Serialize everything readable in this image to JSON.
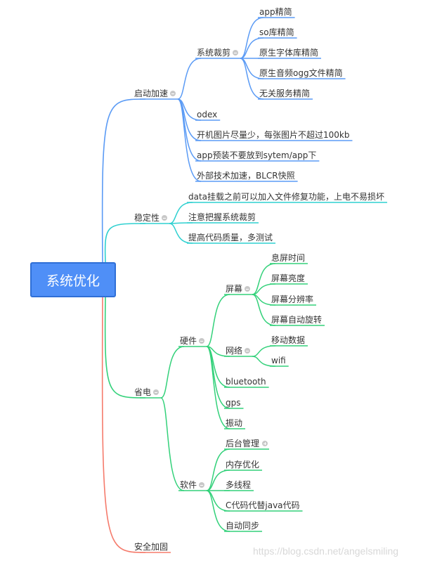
{
  "root": {
    "label": "系统优化",
    "color": "#4f8ff7"
  },
  "branches": {
    "startup": {
      "label": "启动加速",
      "color": "#5b9bf5",
      "tailor": {
        "label": "系统裁剪",
        "items": [
          "app精简",
          "so库精简",
          "原生字体库精简",
          "原生音频ogg文件精简",
          "无关服务精简"
        ]
      },
      "items": [
        "odex",
        "开机图片尽量少，每张图片不超过100kb",
        "app预装不要放到sytem/app下",
        "外部技术加速，BLCR快照"
      ]
    },
    "stability": {
      "label": "稳定性",
      "color": "#2fd0d0",
      "items": [
        "data挂载之前可以加入文件修复功能，上电不易损坏",
        "注意把握系统裁剪",
        "提高代码质量，多测试"
      ]
    },
    "power": {
      "label": "省电",
      "color": "#33d17a",
      "hardware": {
        "label": "硬件",
        "screen": {
          "label": "屏幕",
          "items": [
            "息屏时间",
            "屏幕亮度",
            "屏幕分辨率",
            "屏幕自动旋转"
          ]
        },
        "network": {
          "label": "网络",
          "items": [
            "移动数据",
            "wifi"
          ]
        },
        "items": [
          "bluetooth",
          "gps",
          "振动"
        ]
      },
      "software": {
        "label": "软件",
        "items": [
          "后台管理",
          "内存优化",
          "多线程",
          "C代码代替java代码",
          "自动同步"
        ]
      }
    },
    "security": {
      "label": "安全加固",
      "color": "#f57b6c"
    }
  },
  "watermark": "https://blog.csdn.net/angelsmiling"
}
